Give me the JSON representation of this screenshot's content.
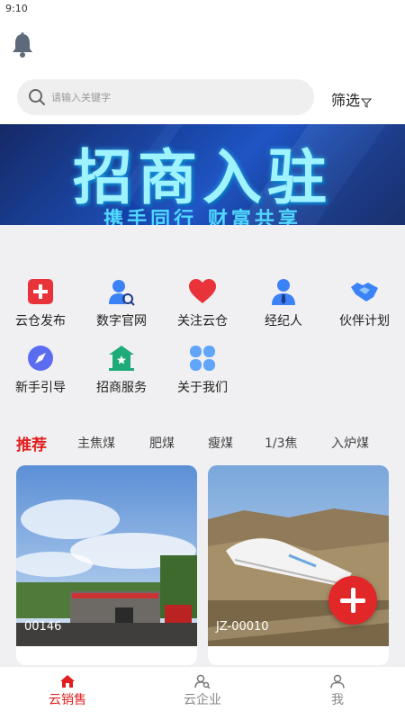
{
  "status_bar": {
    "time": "9:10"
  },
  "header": {
    "search_placeholder": "请输入关键字",
    "filter_label": "筛选"
  },
  "banner": {
    "title": "招商入驻",
    "subtitle": "携手同行 财富共享"
  },
  "menu": {
    "items": [
      {
        "label": "云仓发布",
        "icon": "plus-box-icon"
      },
      {
        "label": "数字官网",
        "icon": "user-search-icon"
      },
      {
        "label": "关注云仓",
        "icon": "heart-icon"
      },
      {
        "label": "经纪人",
        "icon": "agent-icon"
      },
      {
        "label": "伙伴计划",
        "icon": "handshake-icon"
      },
      {
        "label": "新手引导",
        "icon": "compass-icon"
      },
      {
        "label": "招商服务",
        "icon": "store-icon"
      },
      {
        "label": "关于我们",
        "icon": "clover-icon"
      }
    ]
  },
  "tabs": [
    "推荐",
    "主焦煤",
    "肥煤",
    "瘦煤",
    "1/3焦",
    "入炉煤"
  ],
  "cards": [
    {
      "code": "00146"
    },
    {
      "code": "JZ-00010"
    }
  ],
  "bottom_nav": {
    "items": [
      {
        "label": "云销售",
        "icon": "home-icon"
      },
      {
        "label": "云企业",
        "icon": "enterprise-icon"
      },
      {
        "label": "我",
        "icon": "person-icon"
      }
    ]
  },
  "colors": {
    "accent": "#e02020",
    "banner_bg": "#113a9a"
  }
}
